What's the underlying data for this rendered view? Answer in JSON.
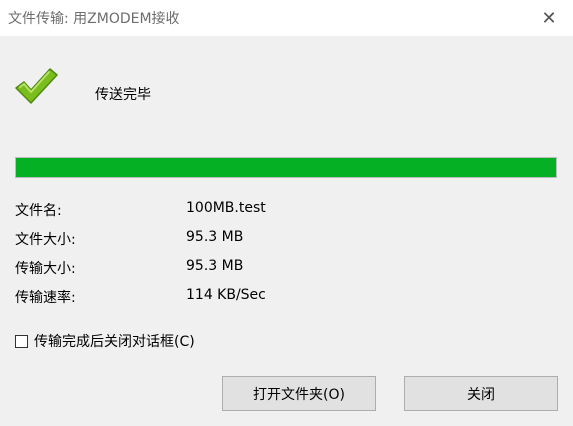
{
  "window": {
    "title": "文件传输: 用ZMODEM接收",
    "close_glyph": "✕"
  },
  "status": {
    "text": "传送完毕",
    "icon": "checkmark-icon",
    "icon_color": "#7cbd1e"
  },
  "progress": {
    "percent": 100,
    "color": "#06b025"
  },
  "info": {
    "filename_label": "文件名:",
    "filename_value": "100MB.test",
    "filesize_label": "文件大小:",
    "filesize_value": "95.3 MB",
    "transferred_label": "传输大小:",
    "transferred_value": "95.3 MB",
    "speed_label": "传输速率:",
    "speed_value": "114 KB/Sec"
  },
  "options": {
    "close_on_complete_label": "传输完成后关闭对话框(C)",
    "close_on_complete_checked": false
  },
  "buttons": {
    "open_folder_label": "打开文件夹(O)",
    "close_label": "关闭"
  }
}
